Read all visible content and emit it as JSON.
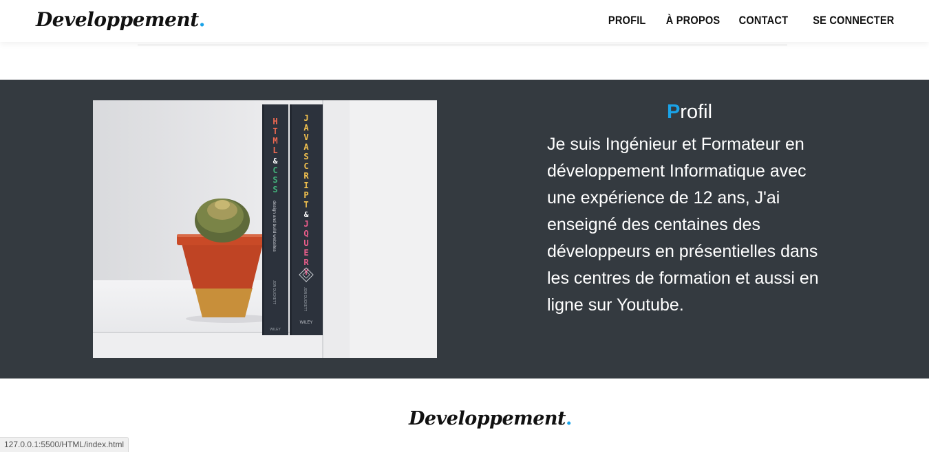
{
  "header": {
    "logo_text": "Developpement",
    "logo_dot": ".",
    "nav": [
      {
        "label": "PROFIL"
      },
      {
        "label": "À PROPOS"
      },
      {
        "label": "CONTACT"
      },
      {
        "label": "SE CONNECTER"
      }
    ]
  },
  "profile": {
    "title_first": "P",
    "title_rest": "rofil",
    "text": "Je suis Ingénieur et Formateur en développement Informatique avec une expérience de 12 ans, J'ai enseigné des centaines des développeurs en présentielles dans les centres de formation et aussi en ligne sur Youtube.",
    "image": {
      "book1": {
        "title1": "HTML",
        "amp": "&",
        "title2": "CSS",
        "subtitle": "design and build websites",
        "author": "JON DUCKETT",
        "publisher": "WILEY"
      },
      "book2": {
        "title1": "JAVASCRIPT",
        "amp": "&",
        "title2": "JQUERY",
        "author": "JON DUCKETT",
        "publisher": "WILEY"
      }
    }
  },
  "footer": {
    "logo_text": "Developpement",
    "logo_dot": "."
  },
  "status_bar": {
    "url": "127.0.0.1:5500/HTML/index.html"
  },
  "colors": {
    "accent": "#1aa3e8",
    "band": "#343a40",
    "text_dark": "#111111"
  }
}
